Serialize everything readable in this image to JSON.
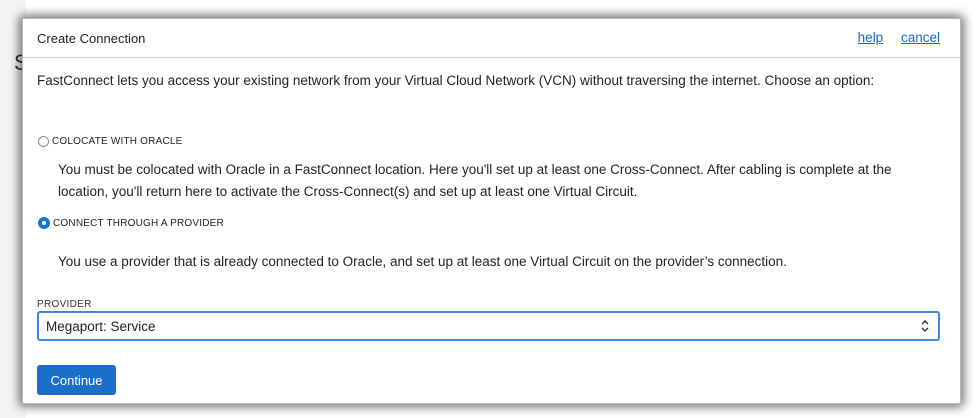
{
  "backdrop": {
    "partial_glyph": "S"
  },
  "dialog": {
    "title": "Create Connection",
    "links": {
      "help": "help",
      "cancel": "cancel"
    },
    "intro": "FastConnect lets you access your existing network from your Virtual Cloud Network (VCN) without traversing the internet. Choose an option:",
    "options": [
      {
        "label": "COLOCATE WITH ORACLE",
        "checked": false,
        "description": "You must be colocated with Oracle in a FastConnect location. Here you'll set up at least one Cross-Connect. After cabling is complete at the location, you'll return here to activate the Cross-Connect(s) and set up at least one Virtual Circuit."
      },
      {
        "label": "CONNECT THROUGH A PROVIDER",
        "checked": true,
        "description": "You use a provider that is already connected to Oracle, and set up at least one Virtual Circuit on the provider’s connection."
      }
    ],
    "provider": {
      "label": "PROVIDER",
      "selected": "Megaport: Service"
    },
    "continue_label": "Continue"
  },
  "colors": {
    "accent": "#1b6fc9",
    "link": "#1a66c9",
    "focus_border": "#3b86e0"
  }
}
